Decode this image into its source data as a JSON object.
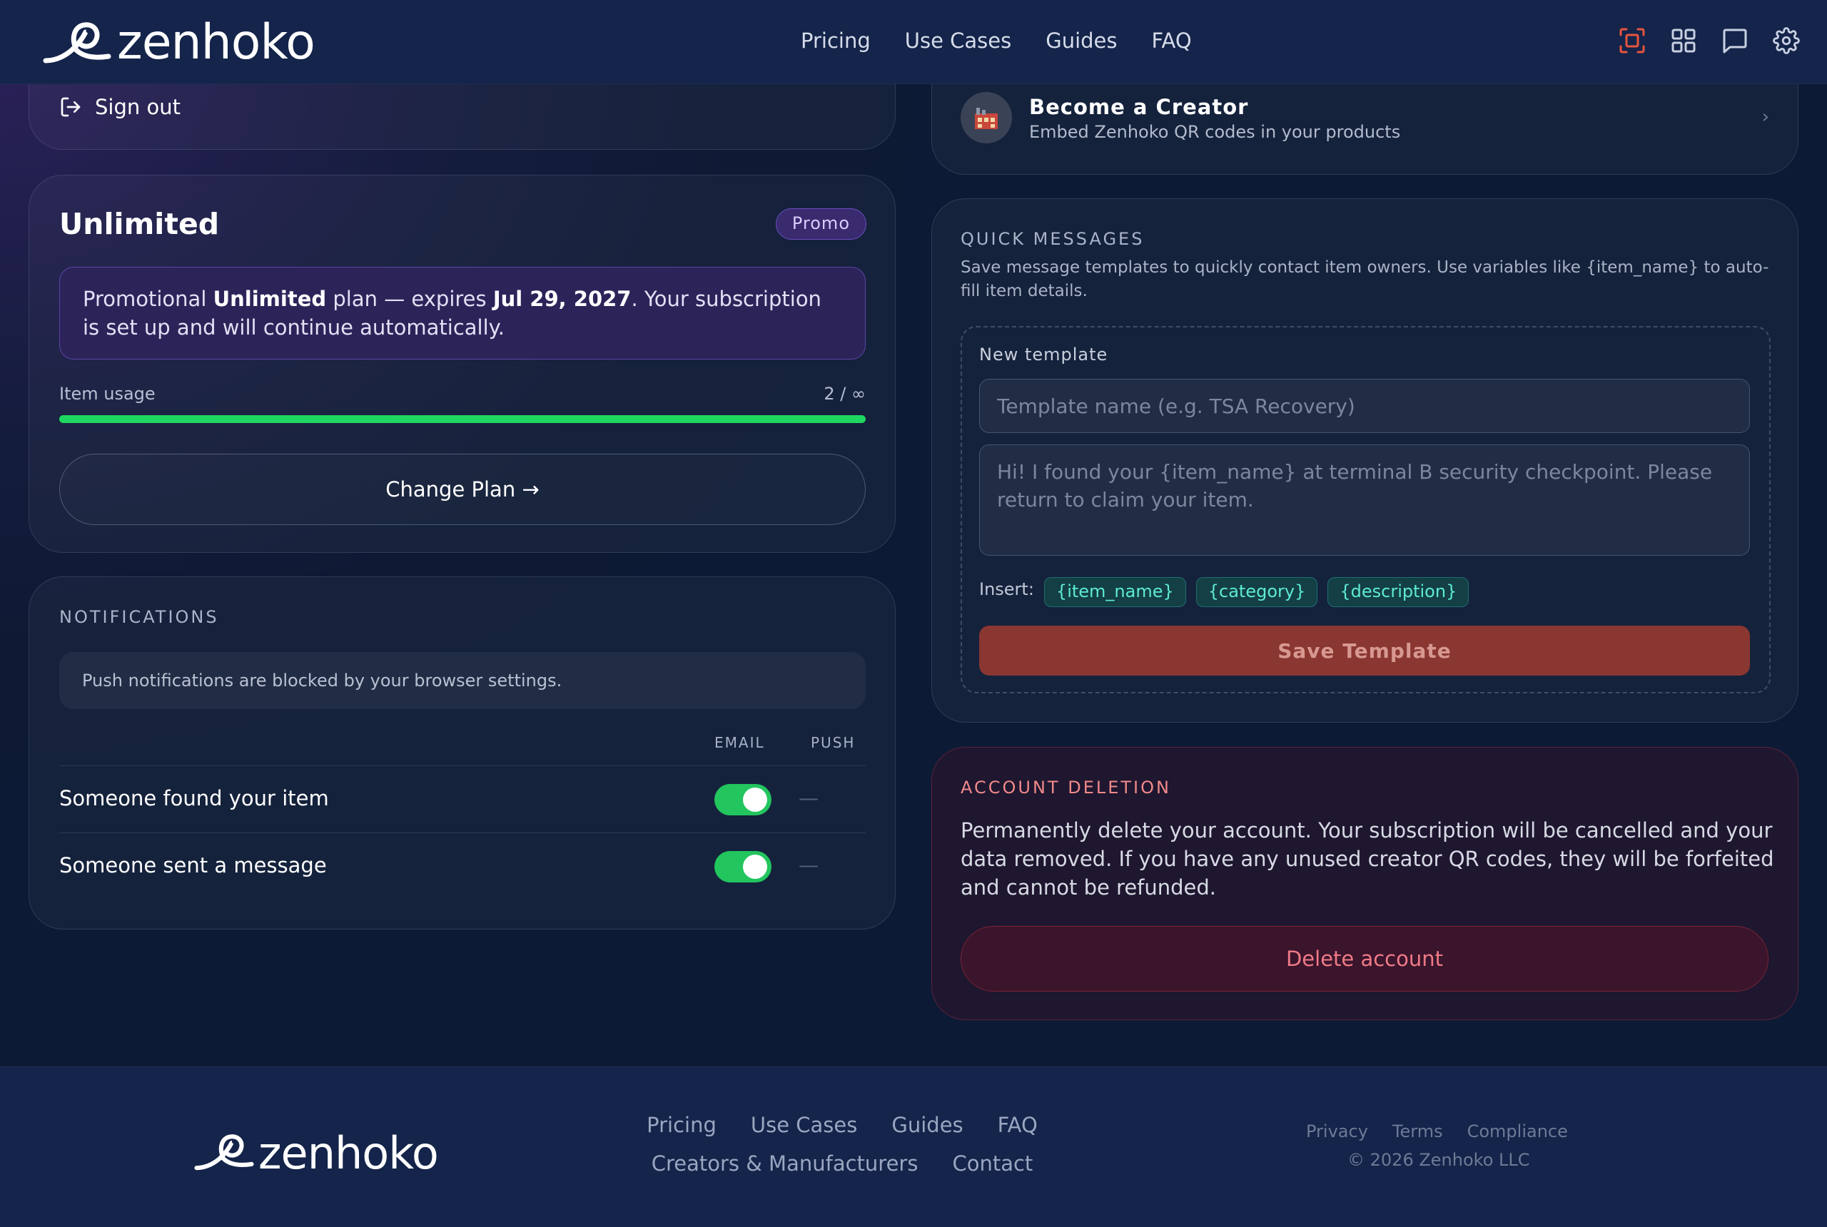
{
  "header": {
    "brand": "zenhoko",
    "nav": [
      "Pricing",
      "Use Cases",
      "Guides",
      "FAQ"
    ],
    "icons": [
      "scan-icon",
      "grid-icon",
      "chat-icon",
      "gear-icon"
    ],
    "accent_color": "#e8553f"
  },
  "account": {
    "signout_label": "Sign out"
  },
  "plan": {
    "title": "Unlimited",
    "badge": "Promo",
    "promo_prefix": "Promotional ",
    "promo_plan": "Unlimited",
    "promo_mid": " plan — expires ",
    "promo_date": "Jul 29, 2027",
    "promo_suffix": ". Your subscription is set up and will continue automatically.",
    "usage_label": "Item usage",
    "usage_value": "2 / ∞",
    "usage_fraction": 1.0,
    "change_plan_label": "Change Plan →"
  },
  "notifications": {
    "section_label": "NOTIFICATIONS",
    "blocked_message": "Push notifications are blocked by your browser settings.",
    "col_email": "EMAIL",
    "col_push": "PUSH",
    "rows": [
      {
        "label": "Someone found your item",
        "email_on": true,
        "push": "—"
      },
      {
        "label": "Someone sent a message",
        "email_on": true,
        "push": "—"
      }
    ]
  },
  "creator": {
    "title": "Become a Creator",
    "subtitle": "Embed Zenhoko QR codes in your products",
    "chevron": "›"
  },
  "quick_messages": {
    "section_label": "QUICK MESSAGES",
    "description": "Save message templates to quickly contact item owners. Use variables like {item_name} to auto-fill item details.",
    "new_template_label": "New template",
    "name_placeholder": "Template name (e.g. TSA Recovery)",
    "body_placeholder": "Hi! I found your {item_name} at terminal B security checkpoint. Please return to claim your item.",
    "insert_label": "Insert:",
    "chips": [
      "{item_name}",
      "{category}",
      "{description}"
    ],
    "save_label": "Save Template"
  },
  "deletion": {
    "section_label": "ACCOUNT DELETION",
    "text": "Permanently delete your account. Your subscription will be cancelled and your data removed. If you have any unused creator QR codes, they will be forfeited and cannot be refunded.",
    "button_label": "Delete account"
  },
  "footer": {
    "brand": "zenhoko",
    "nav": [
      "Pricing",
      "Use Cases",
      "Guides",
      "FAQ",
      "Creators & Manufacturers",
      "Contact"
    ],
    "legal": [
      "Privacy",
      "Terms",
      "Compliance"
    ],
    "copyright": "© 2026 Zenhoko LLC"
  }
}
